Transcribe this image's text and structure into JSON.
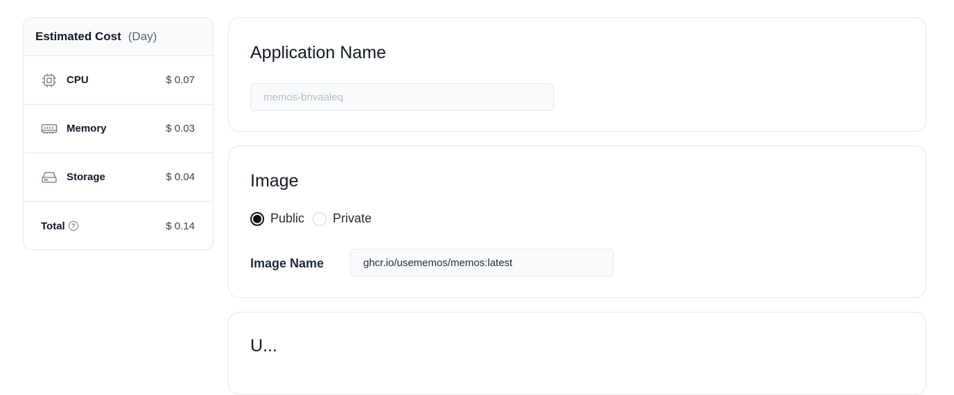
{
  "cost": {
    "title": "Estimated Cost",
    "period": "(Day)",
    "rows": [
      {
        "label": "CPU",
        "price": "$ 0.07",
        "icon": "cpu-icon"
      },
      {
        "label": "Memory",
        "price": "$ 0.03",
        "icon": "memory-icon"
      },
      {
        "label": "Storage",
        "price": "$ 0.04",
        "icon": "storage-icon"
      }
    ],
    "total": {
      "label": "Total",
      "price": "$ 0.14",
      "icon": "help-circle-icon",
      "glyph": "?"
    }
  },
  "app_name": {
    "title": "Application Name",
    "placeholder": "memos-bnvaaleq",
    "value": ""
  },
  "image": {
    "title": "Image",
    "options": [
      {
        "label": "Public",
        "selected": true
      },
      {
        "label": "Private",
        "selected": false
      }
    ],
    "name_label": "Image Name",
    "name_value": "ghcr.io/usememos/memos:latest"
  },
  "next_section": {
    "title": "U..."
  }
}
